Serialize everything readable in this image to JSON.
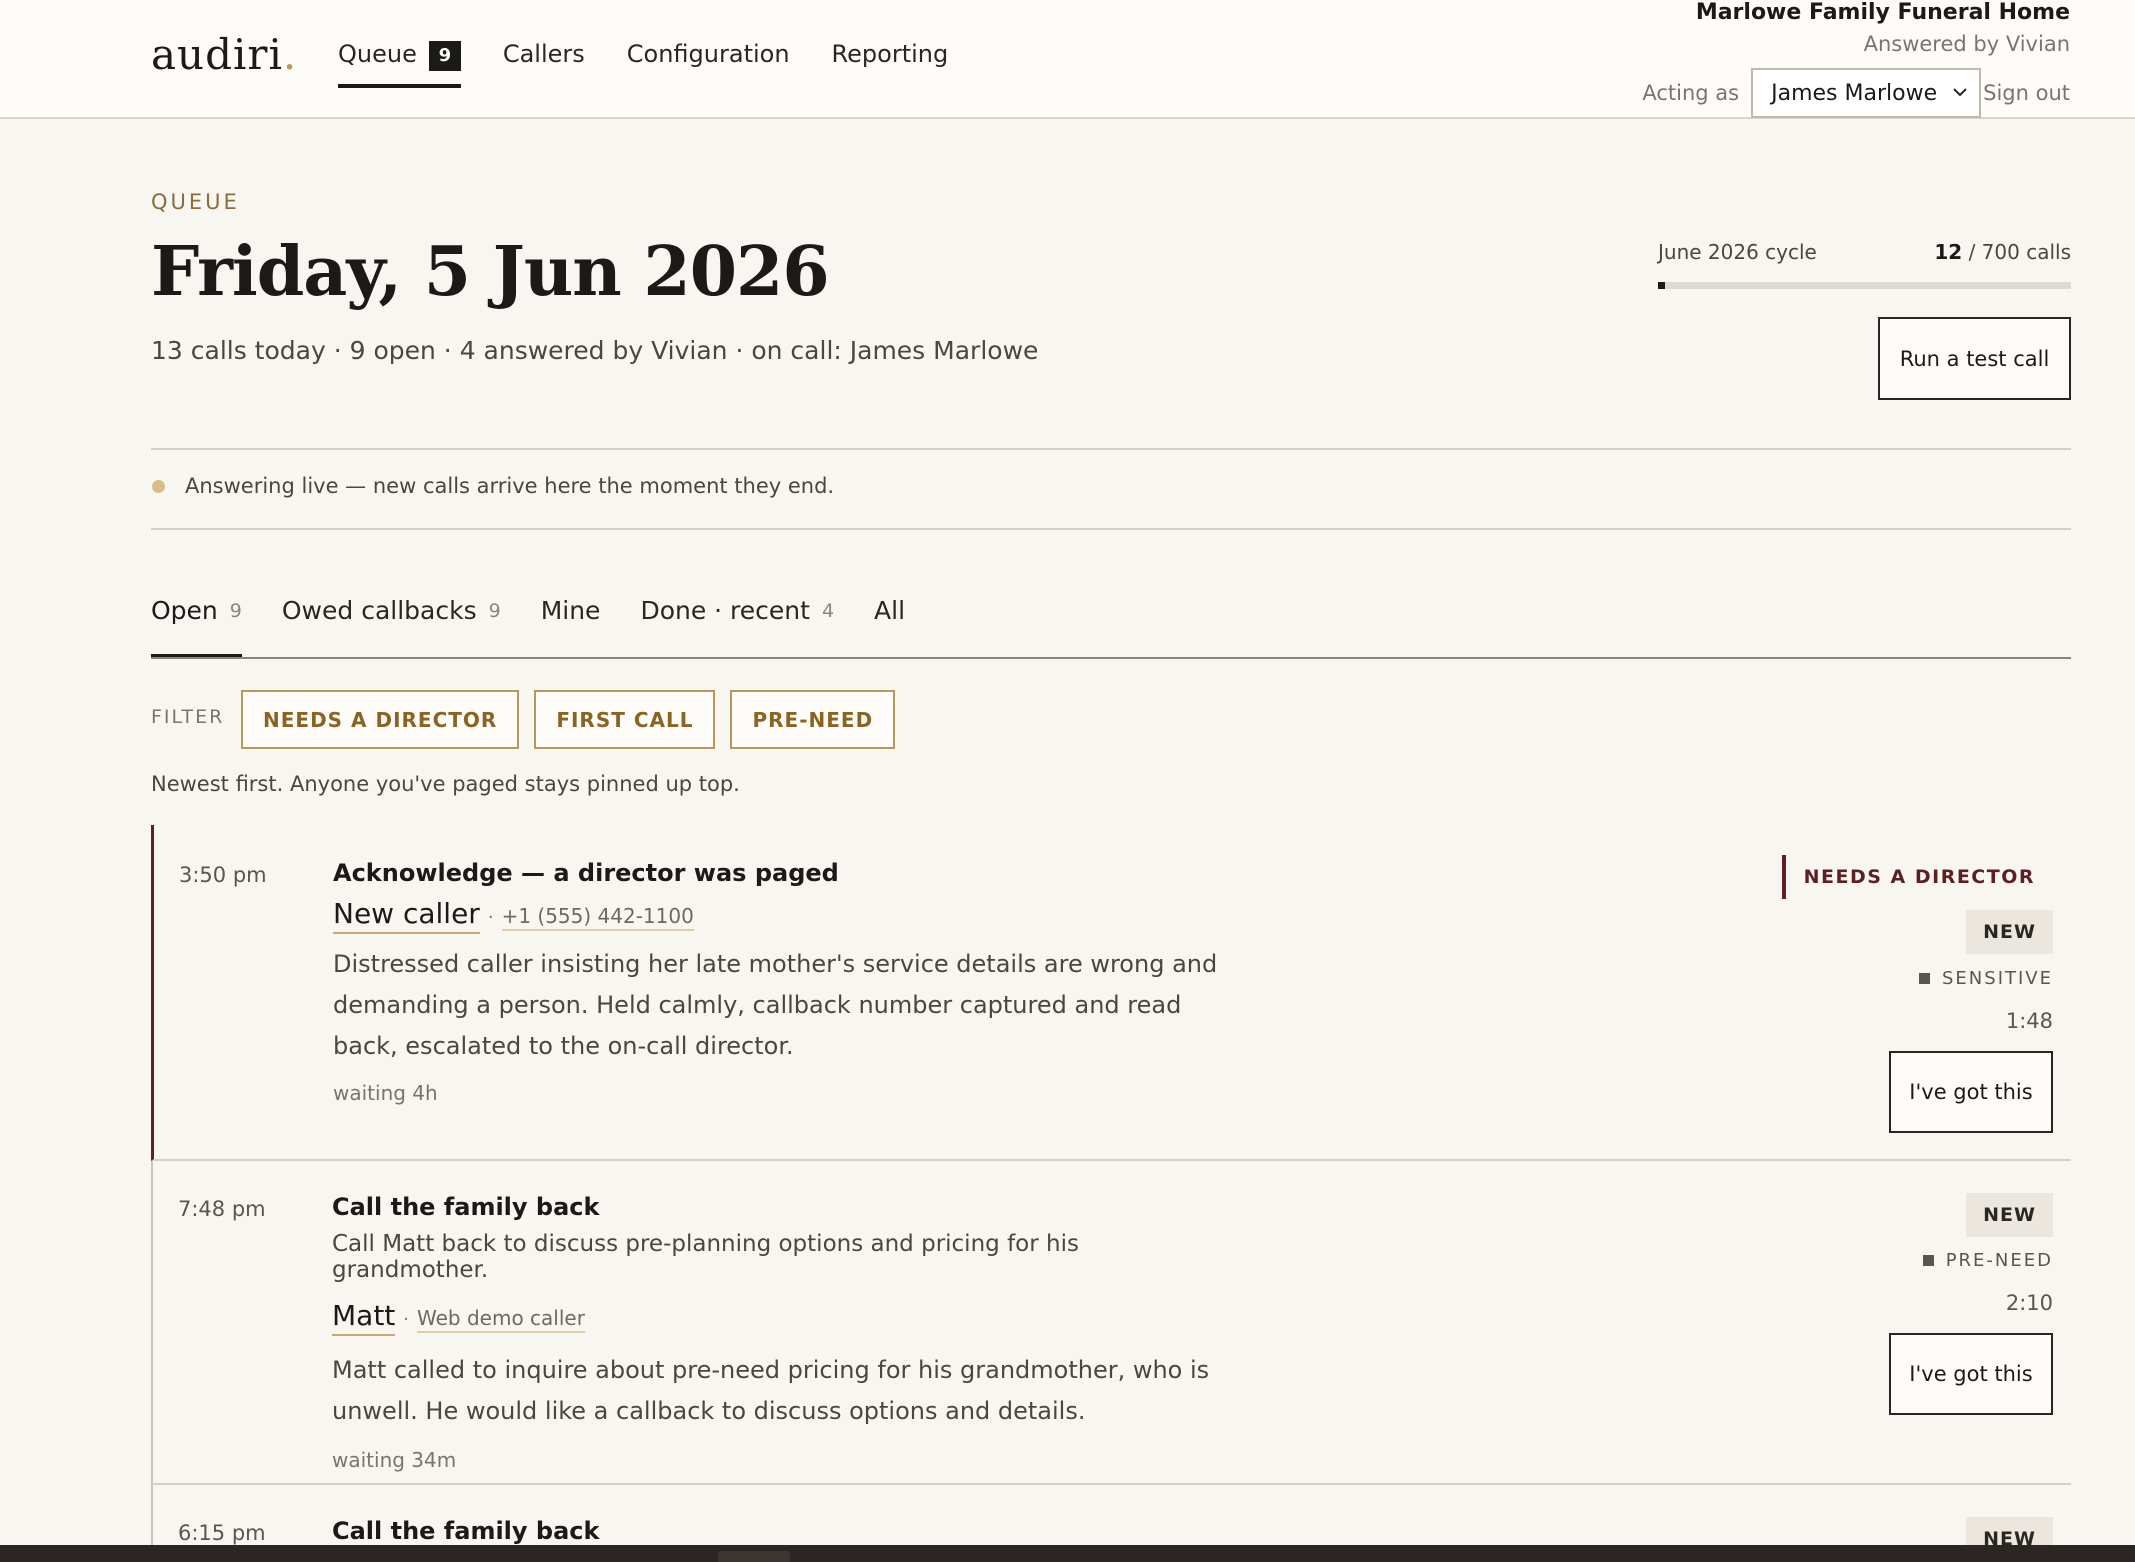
{
  "app": {
    "logo": "audiri",
    "logo_dot": ".",
    "nav": [
      {
        "label": "Queue",
        "badge": "9"
      },
      {
        "label": "Callers"
      },
      {
        "label": "Configuration"
      },
      {
        "label": "Reporting"
      }
    ],
    "org_name": "Marlowe Family Funeral Home",
    "org_sub": "Answered by Vivian",
    "acting_label": "Acting as",
    "acting_value": "James Marlowe",
    "sign_out": "Sign out"
  },
  "header": {
    "eyebrow": "QUEUE",
    "title": "Friday, 5 Jun 2026",
    "summary": "13 calls today · 9 open · 4 answered by Vivian · on call: James Marlowe",
    "cycle_label": "June 2026 cycle",
    "cycle_used": "12",
    "cycle_total": " / 700 calls",
    "cycle_fraction": 0.0171,
    "test_call": "Run a test call"
  },
  "live": {
    "text": "Answering live — new calls arrive here the moment they end.",
    "dot_color": "#d8bd89"
  },
  "tabs": [
    {
      "label": "Open",
      "count": "9"
    },
    {
      "label": "Owed callbacks",
      "count": "9"
    },
    {
      "label": "Mine",
      "count": ""
    },
    {
      "label": "Done · recent",
      "count": "4"
    },
    {
      "label": "All",
      "count": ""
    }
  ],
  "filter": {
    "label": "FILTER",
    "chips": [
      "NEEDS A DIRECTOR",
      "FIRST CALL",
      "PRE-NEED"
    ]
  },
  "hint": "Newest first. Anyone you've paged stays pinned up top.",
  "calls": [
    {
      "time": "3:50 pm",
      "title": "Acknowledge — a director was paged",
      "caller": "New caller",
      "caller_meta": "+1 (555) 442-1100",
      "desc_lines": [
        "Distressed caller insisting her late mother's service details are wrong and",
        "demanding a person. Held calmly, callback number captured and read",
        "back, escalated to the on-call director."
      ],
      "waiting": "waiting 4h",
      "tag": "NEEDS A DIRECTOR",
      "status": "NEW",
      "flag": "SENSITIVE",
      "duration": "1:48",
      "action": "I've got this"
    },
    {
      "time": "7:48 pm",
      "title": "Call the family back",
      "subtitle": "Call Matt back to discuss pre-planning options and pricing for his grandmother.",
      "caller": "Matt",
      "caller_meta": "Web demo caller",
      "desc_lines": [
        "Matt called to inquire about pre-need pricing for his grandmother, who is",
        "unwell. He would like a callback to discuss options and details."
      ],
      "waiting": "waiting 34m",
      "status": "NEW",
      "flag": "PRE-NEED",
      "duration": "2:10",
      "action": "I've got this"
    },
    {
      "time": "6:15 pm",
      "title": "Call the family back",
      "status": "NEW"
    }
  ],
  "colors": {
    "accent_gold": "#b8975c",
    "urgent": "#5e1f24",
    "ink": "#1c1a17"
  }
}
